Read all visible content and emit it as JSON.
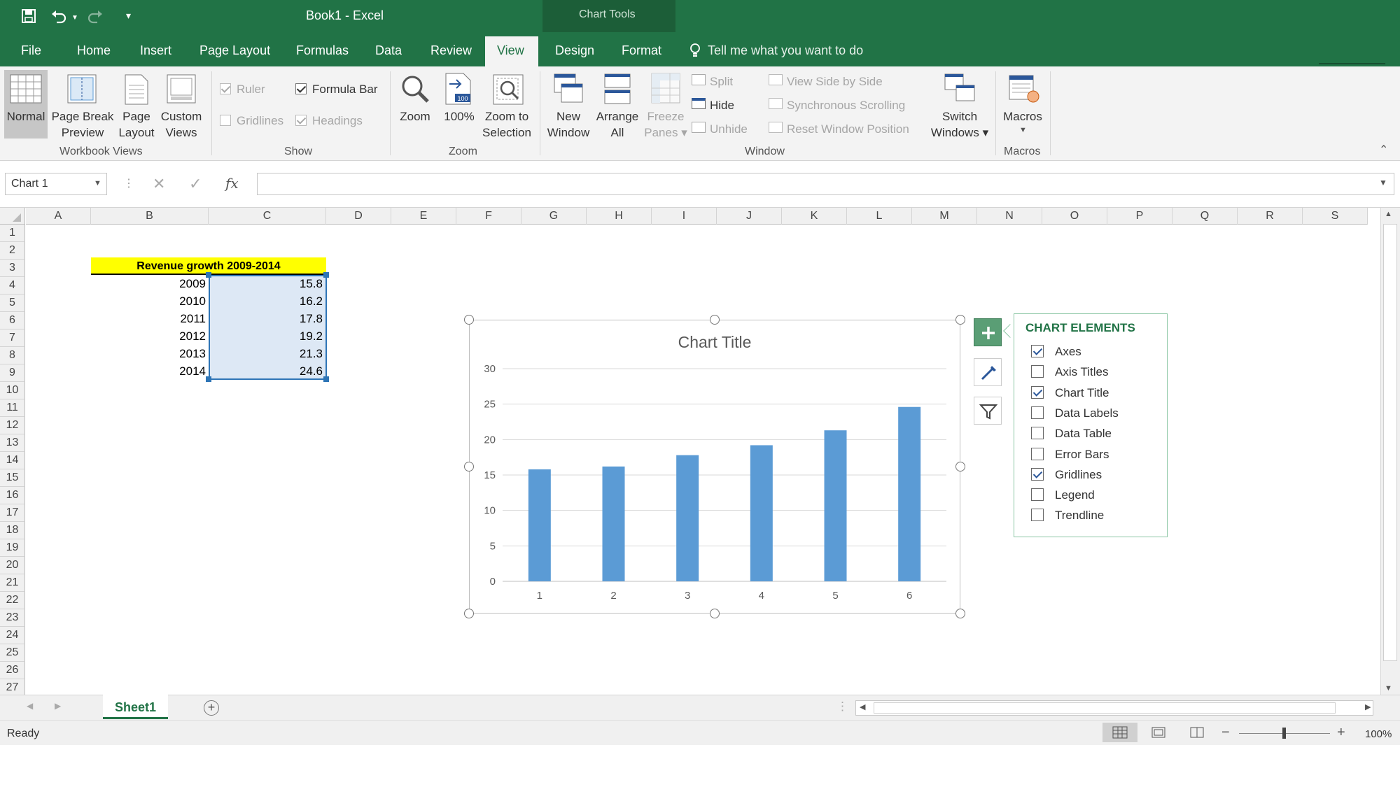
{
  "window": {
    "title": "Book1 - Excel",
    "contextual_tab_group": "Chart Tools",
    "accent_color": "#217346"
  },
  "tabs": [
    {
      "label": "File"
    },
    {
      "label": "Home"
    },
    {
      "label": "Insert"
    },
    {
      "label": "Page Layout"
    },
    {
      "label": "Formulas"
    },
    {
      "label": "Data"
    },
    {
      "label": "Review"
    },
    {
      "label": "View",
      "active": true
    },
    {
      "label": "Design"
    },
    {
      "label": "Format"
    }
  ],
  "tell_me": "Tell me what you want to do",
  "ribbon": {
    "workbook_views": {
      "group_label": "Workbook Views",
      "normal": "Normal",
      "page_break_1": "Page Break",
      "page_break_2": "Preview",
      "page_layout_1": "Page",
      "page_layout_2": "Layout",
      "custom_1": "Custom",
      "custom_2": "Views"
    },
    "show": {
      "group_label": "Show",
      "ruler": "Ruler",
      "formula_bar": "Formula Bar",
      "gridlines": "Gridlines",
      "headings": "Headings"
    },
    "zoom": {
      "group_label": "Zoom",
      "zoom": "Zoom",
      "hundred": "100%",
      "zoom_sel_1": "Zoom to",
      "zoom_sel_2": "Selection"
    },
    "window": {
      "group_label": "Window",
      "new_1": "New",
      "new_2": "Window",
      "arrange_1": "Arrange",
      "arrange_2": "All",
      "freeze_1": "Freeze",
      "freeze_2": "Panes",
      "split": "Split",
      "hide": "Hide",
      "unhide": "Unhide",
      "side_by_side": "View Side by Side",
      "sync_scroll": "Synchronous Scrolling",
      "reset_pos": "Reset Window Position",
      "switch_1": "Switch",
      "switch_2": "Windows"
    },
    "macros": {
      "group_label": "Macros",
      "macros": "Macros"
    }
  },
  "formula_bar": {
    "name_box": "Chart 1",
    "fx": "fx",
    "content": ""
  },
  "grid": {
    "columns": [
      "A",
      "B",
      "C",
      "D",
      "E",
      "F",
      "G",
      "H",
      "I",
      "J",
      "K",
      "L",
      "M",
      "N",
      "O",
      "P",
      "Q",
      "R",
      "S"
    ],
    "rows": [
      "1",
      "2",
      "3",
      "4",
      "5",
      "6",
      "7",
      "8",
      "9",
      "10",
      "11",
      "12",
      "13",
      "14",
      "15",
      "16",
      "17",
      "18",
      "19",
      "20",
      "21",
      "22",
      "23",
      "24",
      "25",
      "26",
      "27"
    ],
    "header_cell": "Revenue growth 2009-2014",
    "header_fill": "#ffff00",
    "data": [
      {
        "year": "2009",
        "value": "15.8"
      },
      {
        "year": "2010",
        "value": "16.2"
      },
      {
        "year": "2011",
        "value": "17.8"
      },
      {
        "year": "2012",
        "value": "19.2"
      },
      {
        "year": "2013",
        "value": "21.3"
      },
      {
        "year": "2014",
        "value": "24.6"
      }
    ]
  },
  "chart_data": {
    "type": "bar",
    "title": "Chart Title",
    "categories": [
      "1",
      "2",
      "3",
      "4",
      "5",
      "6"
    ],
    "values": [
      15.8,
      16.2,
      17.8,
      19.2,
      21.3,
      24.6
    ],
    "ylim": [
      0,
      30
    ],
    "yticks": [
      "0",
      "5",
      "10",
      "15",
      "20",
      "25",
      "30"
    ],
    "grid": true,
    "legend": "none",
    "bar_color": "#5b9bd5"
  },
  "chart_elements": {
    "title": "CHART ELEMENTS",
    "items": [
      {
        "label": "Axes",
        "checked": true
      },
      {
        "label": "Axis Titles",
        "checked": false
      },
      {
        "label": "Chart Title",
        "checked": true
      },
      {
        "label": "Data Labels",
        "checked": false
      },
      {
        "label": "Data Table",
        "checked": false
      },
      {
        "label": "Error Bars",
        "checked": false
      },
      {
        "label": "Gridlines",
        "checked": true
      },
      {
        "label": "Legend",
        "checked": false
      },
      {
        "label": "Trendline",
        "checked": false
      }
    ]
  },
  "sheet_tabs": [
    {
      "label": "Sheet1",
      "active": true
    }
  ],
  "status": {
    "ready": "Ready",
    "zoom": "100%"
  }
}
